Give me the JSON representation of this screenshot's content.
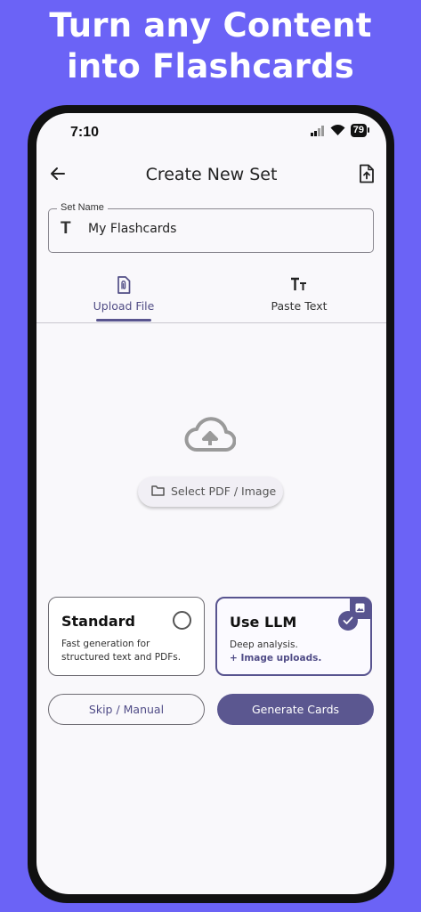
{
  "headline": {
    "line1": "Turn any Content",
    "line2": "into Flashcards"
  },
  "status_bar": {
    "time": "7:10",
    "battery": "79"
  },
  "appbar": {
    "title": "Create New Set",
    "back_icon": "arrow-left-icon",
    "export_icon": "file-upload-icon"
  },
  "set_name": {
    "label": "Set Name",
    "value": "My Flashcards",
    "icon": "text-T-icon"
  },
  "tabs": [
    {
      "label": "Upload File",
      "icon": "file-icon",
      "selected": true
    },
    {
      "label": "Paste Text",
      "icon": "text-size-icon",
      "selected": false
    }
  ],
  "upload": {
    "icon": "cloud-upload-icon",
    "select_label": "Select PDF / Image",
    "select_icon": "folder-icon"
  },
  "modes": [
    {
      "title": "Standard",
      "description": "Fast generation for structured text and PDFs.",
      "selected": false
    },
    {
      "title": "Use LLM",
      "description": "Deep analysis.",
      "extra": "+ Image uploads.",
      "selected": true
    }
  ],
  "actions": {
    "skip_label": "Skip / Manual",
    "generate_label": "Generate Cards"
  },
  "colors": {
    "background": "#6b63f6",
    "accent": "#5b5790",
    "screen": "#f9f8fb"
  }
}
